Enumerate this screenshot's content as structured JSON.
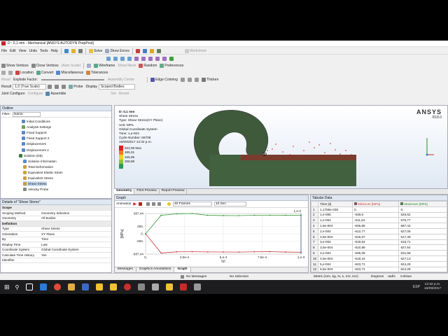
{
  "window": {
    "title": "D : 0,1 mm - Mechanical [ANSYS AUTODYN PrepPost]"
  },
  "menu": [
    "File",
    "Edit",
    "View",
    "Units",
    "Tools",
    "Help"
  ],
  "toolbar1": {
    "solve": "Solve",
    "show_errors": "Show Errors",
    "worksheet": "Worksheet"
  },
  "toolbar2": {
    "show_vertices": "Show Vertices",
    "close_vertices": "Close Vertices",
    "auto_scale": "(Auto Scale)",
    "wireframe": "Wireframe",
    "show_mesh": "Show Mesh",
    "random": "Random",
    "preferences": "Preferences"
  },
  "toolbar3": {
    "location": "Location",
    "convert": "Convert",
    "miscellaneous": "Miscellaneous",
    "tolerances": "Tolerances"
  },
  "toolbar4": {
    "reset": "Reset",
    "explode_factor": "Explode Factor:",
    "assembly_center": "Assembly Center",
    "edge_coloring": "Edge Coloring",
    "thicken": "Thicken"
  },
  "toolbar5": {
    "result": "Result",
    "scale": "1,0 (True Scale)",
    "probe": "Probe",
    "display": "Display",
    "scoped_bodies": "Scoped Bodies"
  },
  "toolbar6": {
    "joint_config": "Joint Configure",
    "configure": "Configure",
    "assemble": "Assemble",
    "set": "Set",
    "revert": "Revert"
  },
  "outline": {
    "title": "Outline",
    "filter_label": "Filter:",
    "filter_value": "Name",
    "items": [
      {
        "label": "Initial Conditions",
        "color": "#5a88c8"
      },
      {
        "label": "Analysis Settings",
        "color": "#6aa05a"
      },
      {
        "label": "Fixed Support",
        "color": "#5a88c8"
      },
      {
        "label": "Fixed Support 2",
        "color": "#5a88c8"
      },
      {
        "label": "Displacement",
        "color": "#5a88c8"
      },
      {
        "label": "Displacement 2",
        "color": "#5a88c8"
      },
      {
        "label": "Solution (D6)",
        "color": "#3a7a3a"
      },
      {
        "label": "Solution Information",
        "color": "#5a88c8"
      },
      {
        "label": "Total Deformation",
        "color": "#c8a040"
      },
      {
        "label": "Equivalent Elastic Strain",
        "color": "#c8a040"
      },
      {
        "label": "Equivalent Stress",
        "color": "#c8a040"
      },
      {
        "label": "Shear Stress",
        "color": "#c8a040"
      },
      {
        "label": "Velocity Probe",
        "color": "#888888"
      }
    ]
  },
  "details": {
    "title": "Details of \"Shear Stress\"",
    "groups": [
      {
        "name": "Scope",
        "rows": [
          [
            "Scoping Method",
            "Geometry Selection"
          ],
          [
            "Geometry",
            "All Bodies"
          ]
        ]
      },
      {
        "name": "Definition",
        "rows": [
          [
            "Type",
            "Shear Stress"
          ],
          [
            "Orientation",
            "XY Plane"
          ],
          [
            "By",
            "Time"
          ],
          [
            "Display Time",
            "Last"
          ],
          [
            "Coordinate System",
            "Global Coordinate System"
          ],
          [
            "Calculate Time History",
            "Yes"
          ],
          [
            "Identifier",
            ""
          ]
        ]
      }
    ]
  },
  "viewport": {
    "info": [
      "D: 0,1 mm",
      "Shear Stress",
      "Type: Shear Stress(XY Plane)",
      "Unit: MPa",
      "Global Coordinate System",
      "Time: 1,e-003",
      "Cycle Number: 66708",
      "16/09/2017 12:32 p.m."
    ],
    "legend": [
      {
        "label": "623,08 Max",
        "color": "#e0201a"
      },
      {
        "label": "485,01",
        "color": "#f07a1a"
      },
      {
        "label": "346,95",
        "color": "#f0d02a"
      },
      {
        "label": "208,89",
        "color": "#88c83a"
      },
      {
        "label": "",
        "color": "#2a9a5a"
      }
    ],
    "brand": "ANSYS",
    "version": "R18.0"
  },
  "view_tabs": [
    "Geometry",
    "Print Preview",
    "Report Preview"
  ],
  "graph": {
    "title": "Graph",
    "animation": "Animation",
    "frames": "40 Frames",
    "duration": "10 Sec",
    "y_unit": "[MPa]",
    "x_unit": "[s]",
    "top_right": "1,e-3",
    "page_index": "1",
    "tabs": [
      "Messages",
      "Graphics Annotations",
      "Graph"
    ]
  },
  "chart_data": {
    "type": "line",
    "title": "",
    "xlabel": "[s]",
    "ylabel": "[MPa]",
    "xlim": [
      0,
      0.001
    ],
    "ylim": [
      -687.44,
      687.44
    ],
    "x_ticks": [
      "0,",
      "2,5e-4",
      "5,e-4",
      "7,5e-4",
      "1,e-3"
    ],
    "y_ticks": [
      "687,44",
      "250,",
      "0,",
      "-250,",
      "-687,44"
    ],
    "grid": true,
    "series": [
      {
        "name": "Minimum [MPa]",
        "color": "#c83a3a",
        "x": [
          0.0,
          0.0001,
          0.0002,
          0.0003,
          0.0004,
          0.0005,
          0.0006,
          0.0007,
          0.0008,
          0.0009,
          0.001
        ],
        "y": [
          0,
          -649.6,
          -611.54,
          -606.86,
          -612.77,
          -615.67,
          -619.64,
          -610.89,
          -605.08,
          -618.24,
          -623.71
        ]
      },
      {
        "name": "Maximum [MPa]",
        "color": "#3a9a3a",
        "x": [
          0.0,
          0.0001,
          0.0002,
          0.0003,
          0.0004,
          0.0005,
          0.0006,
          0.0007,
          0.0008,
          0.0009,
          0.001
        ],
        "y": [
          0,
          626.62,
          675.77,
          687.44,
          627.05,
          617.39,
          615.71,
          627.64,
          631.68,
          627.13,
          624.28
        ]
      }
    ]
  },
  "tabular": {
    "title": "Tabular Data",
    "headers": [
      "",
      "Time [s]",
      "Minimum [MPa]",
      "Maximum [MPa]"
    ],
    "rows": [
      [
        "1",
        "1,1755e-038",
        "0,",
        "0,"
      ],
      [
        "2",
        "1,e-005",
        "-649,6",
        "626,62"
      ],
      [
        "3",
        "1,e-004",
        "-611,54",
        "675,77"
      ],
      [
        "4",
        "1,5e-004",
        "-606,86",
        "687,44"
      ],
      [
        "5",
        "2,e-004",
        "-612,77",
        "627,05"
      ],
      [
        "6",
        "2,5e-004",
        "-615,67",
        "617,39"
      ],
      [
        "7",
        "3,e-004",
        "-619,64",
        "615,71"
      ],
      [
        "8",
        "3,5e-004",
        "-610,89",
        "627,64"
      ],
      [
        "9",
        "4,e-004",
        "-605,08",
        "631,68"
      ],
      [
        "10",
        "4,5e-004",
        "-618,24",
        "627,13"
      ],
      [
        "11",
        "5,e-004",
        "-623,71",
        "624,28"
      ],
      [
        "12",
        "5,5e-004",
        "-623,71",
        "624,28"
      ]
    ]
  },
  "statusbar": {
    "messages": "No Messages",
    "selection": "No Selection",
    "units": "Metric (mm, kg, N, s, mV, mA)",
    "angle": "Degrees",
    "rate": "rad/s",
    "temp": "Celsius"
  },
  "taskbar": {
    "lang": "ESP",
    "time": "12:32 p.m.",
    "date": "16/09/2017"
  }
}
